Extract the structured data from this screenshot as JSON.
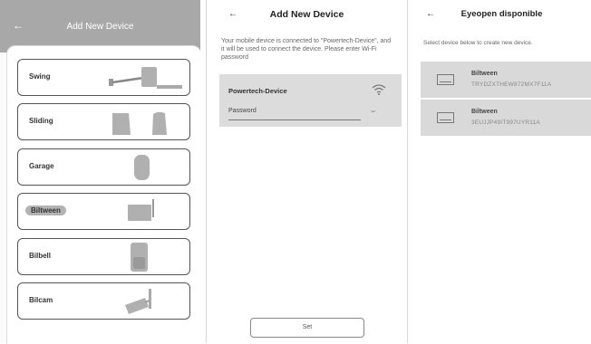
{
  "screen1": {
    "back_label": "←",
    "title": "Add New Device",
    "devices": [
      {
        "label": "Swing"
      },
      {
        "label": "Sliding"
      },
      {
        "label": "Garage"
      },
      {
        "label": "Biltween"
      },
      {
        "label": "Bilbell"
      },
      {
        "label": "Bilcam"
      }
    ]
  },
  "screen2": {
    "back_label": "←",
    "title": "Add New Device",
    "info": "Your mobile device is connected to \"Powertech-Device\", and it will be used to connect the device. Please enter Wi-Fi password",
    "network_name": "Powertech-Device",
    "password_label": "Password",
    "eye_glyph": "⌣",
    "set_button": "Set"
  },
  "screen3": {
    "back_label": "←",
    "title": "Eyeopen disponible",
    "info": "Select device below to create new device.",
    "results": [
      {
        "name": "Biltween",
        "id": "TRYDZXTHEW872MX7F11A"
      },
      {
        "name": "Biltween",
        "id": "3EUJJP49IT997UYR11A"
      }
    ]
  },
  "colors": {
    "header_grey": "#a8a8a8",
    "card_grey": "#d9d9d9",
    "pill_grey": "#b3b3b3"
  }
}
